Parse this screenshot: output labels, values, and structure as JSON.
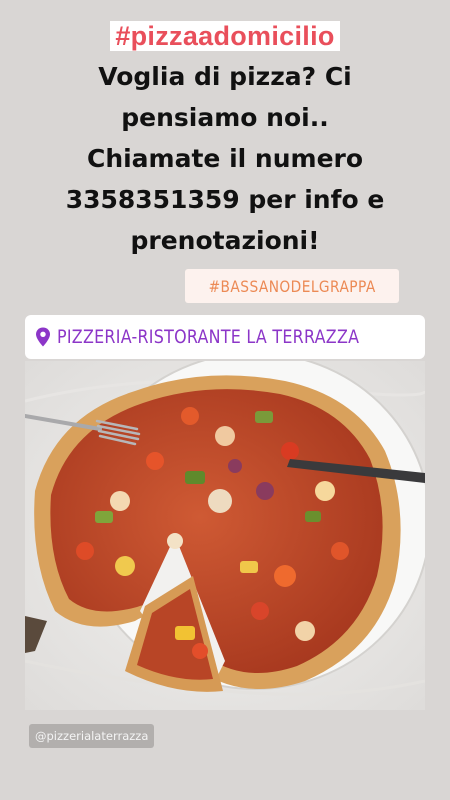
{
  "story": {
    "hashtag_top": "#pizzaadomicilio",
    "headline_lines": [
      "Voglia di pizza? Ci",
      "pensiamo noi..",
      "Chiamate il numero",
      "3358351359 per info e",
      "prenotazioni!"
    ],
    "location_hashtag": "#BASSANODELGRAPPA",
    "location_sticker": {
      "icon": "location-pin-icon",
      "label": "PIZZERIA-RISTORANTE LA TERRAZZA"
    },
    "photo": {
      "subject": "pizza-photo"
    },
    "username": "@pizzerialaterrazza"
  },
  "colors": {
    "background": "#d9d6d4",
    "hashtag": "#e94f5b",
    "location_hashtag": "#ec8a55",
    "location_label": "#8c36c8",
    "sticker_bg": "#ffffff"
  }
}
